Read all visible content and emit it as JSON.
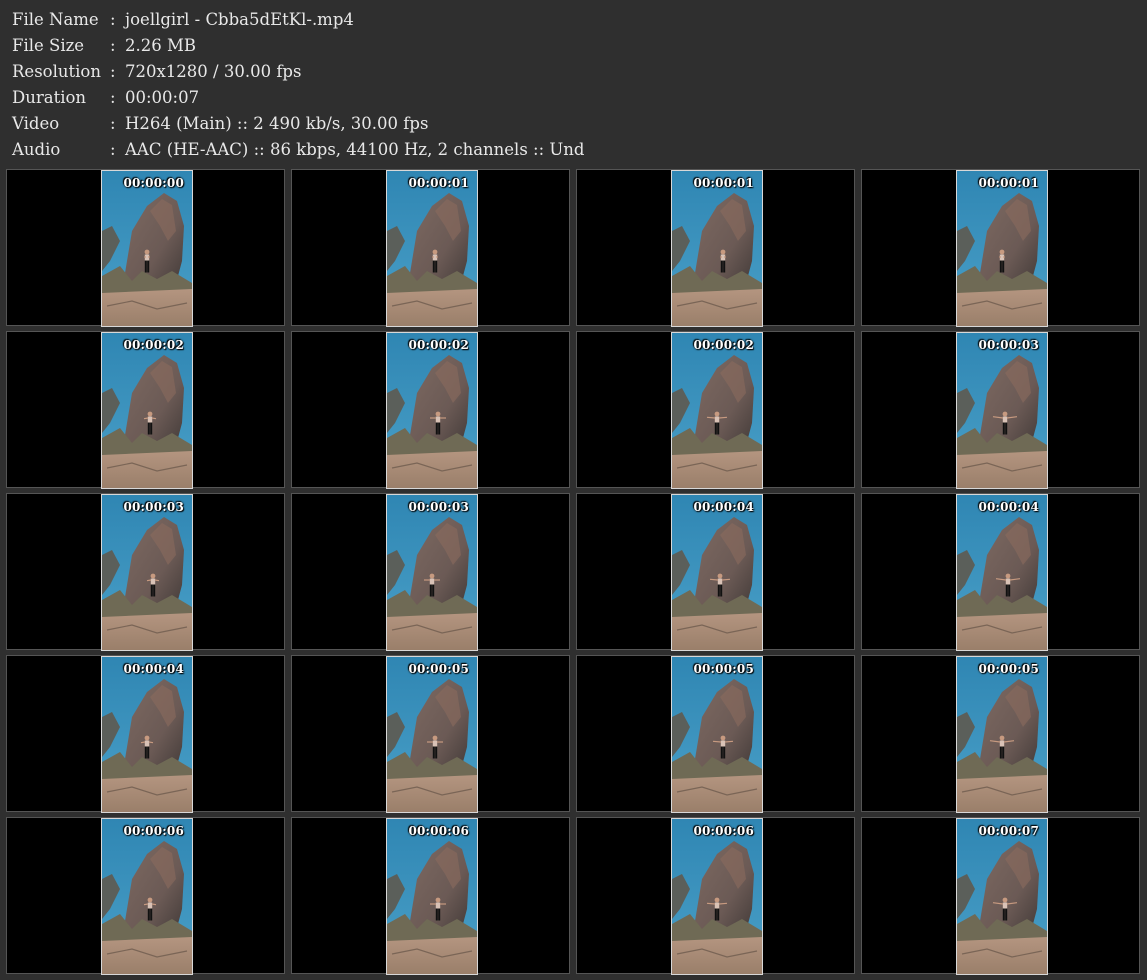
{
  "info": [
    {
      "label": "File Name",
      "value": "joellgirl - Cbba5dEtKl-.mp4"
    },
    {
      "label": "File Size",
      "value": "2.26 MB"
    },
    {
      "label": "Resolution",
      "value": "720x1280 / 30.00 fps"
    },
    {
      "label": "Duration",
      "value": "00:00:07"
    },
    {
      "label": "Video",
      "value": "H264 (Main) :: 2 490 kb/s, 30.00 fps"
    },
    {
      "label": "Audio",
      "value": "AAC (HE-AAC) :: 86 kbps, 44100 Hz, 2 channels :: Und"
    }
  ],
  "separator": ":",
  "frames": [
    "00:00:00",
    "00:00:01",
    "00:00:01",
    "00:00:01",
    "00:00:02",
    "00:00:02",
    "00:00:02",
    "00:00:03",
    "00:00:03",
    "00:00:03",
    "00:00:04",
    "00:00:04",
    "00:00:04",
    "00:00:05",
    "00:00:05",
    "00:00:05",
    "00:00:06",
    "00:00:06",
    "00:00:06",
    "00:00:07"
  ],
  "colors": {
    "background": "#2f2f2f",
    "sky": "#2f86b3",
    "rock": "#6b5a55",
    "ground": "#9a7f6a"
  }
}
